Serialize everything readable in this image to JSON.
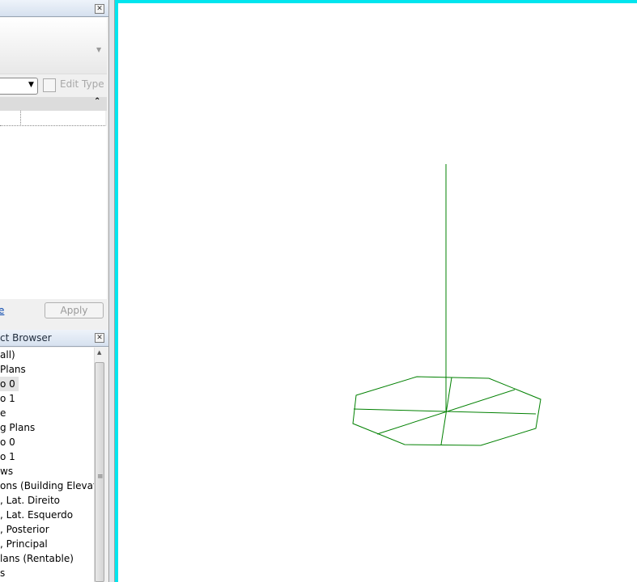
{
  "properties": {
    "edit_type_label": "Edit Type",
    "apply_label": "Apply",
    "link_fragment": "e"
  },
  "browser": {
    "title": "ct Browser",
    "items": [
      "all)",
      "Plans",
      "o 0",
      "o 1",
      "e",
      "g Plans",
      "o 0",
      "o 1",
      "ws",
      "ons (Building Elevatio",
      ", Lat. Direito",
      ", Lat. Esquerdo",
      ", Posterior",
      ", Principal",
      "lans (Rentable)",
      "s"
    ]
  },
  "colors": {
    "viewport_border": "#00e5ee",
    "model_lines": "#008000"
  }
}
